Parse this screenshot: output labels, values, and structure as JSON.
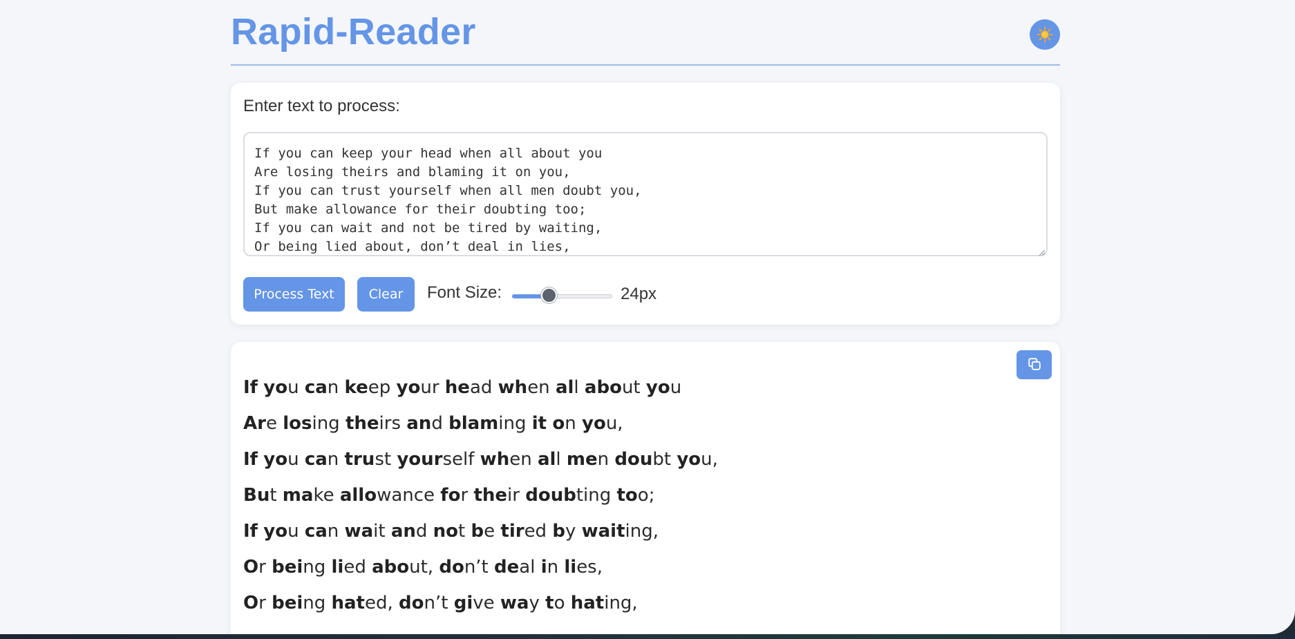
{
  "app": {
    "title": "Rapid-Reader"
  },
  "header": {
    "theme_toggle_icon": "sun-icon"
  },
  "input": {
    "label": "Enter text to process:",
    "text": "If you can keep your head when all about you\nAre losing theirs and blaming it on you,\nIf you can trust yourself when all men doubt you,\nBut make allowance for their doubting too;\nIf you can wait and not be tired by waiting,\nOr being lied about, don’t deal in lies,"
  },
  "controls": {
    "process_label": "Process Text",
    "clear_label": "Clear",
    "font_size_label": "Font Size:",
    "font_size_value": "24px",
    "font_size_slider_fraction": 0.375
  },
  "output": {
    "copy_icon": "copy-icon",
    "lines": [
      [
        [
          "If",
          " "
        ],
        [
          "yo",
          "u "
        ],
        [
          "ca",
          "n "
        ],
        [
          "ke",
          "ep "
        ],
        [
          "yo",
          "ur "
        ],
        [
          "he",
          "ad "
        ],
        [
          "wh",
          "en "
        ],
        [
          "al",
          "l "
        ],
        [
          "abo",
          "ut "
        ],
        [
          "yo",
          "u"
        ]
      ],
      [
        [
          "Ar",
          "e "
        ],
        [
          "los",
          "ing "
        ],
        [
          "the",
          "irs "
        ],
        [
          "an",
          "d "
        ],
        [
          "blam",
          "ing "
        ],
        [
          "it",
          " "
        ],
        [
          "o",
          "n "
        ],
        [
          "yo",
          "u,"
        ]
      ],
      [
        [
          "If",
          " "
        ],
        [
          "yo",
          "u "
        ],
        [
          "ca",
          "n "
        ],
        [
          "tru",
          "st "
        ],
        [
          "your",
          "self "
        ],
        [
          "wh",
          "en "
        ],
        [
          "al",
          "l "
        ],
        [
          "me",
          "n "
        ],
        [
          "dou",
          "bt "
        ],
        [
          "yo",
          "u,"
        ]
      ],
      [
        [
          "Bu",
          "t "
        ],
        [
          "ma",
          "ke "
        ],
        [
          "allo",
          "wance "
        ],
        [
          "fo",
          "r "
        ],
        [
          "the",
          "ir "
        ],
        [
          "doub",
          "ting "
        ],
        [
          "to",
          "o;"
        ]
      ],
      [
        [
          "If",
          " "
        ],
        [
          "yo",
          "u "
        ],
        [
          "ca",
          "n "
        ],
        [
          "wa",
          "it "
        ],
        [
          "an",
          "d "
        ],
        [
          "no",
          "t "
        ],
        [
          "b",
          "e "
        ],
        [
          "tir",
          "ed "
        ],
        [
          "b",
          "y "
        ],
        [
          "wait",
          "ing,"
        ]
      ],
      [
        [
          "O",
          "r "
        ],
        [
          "bei",
          "ng "
        ],
        [
          "li",
          "ed "
        ],
        [
          "abo",
          "ut, "
        ],
        [
          "do",
          "n’t "
        ],
        [
          "de",
          "al "
        ],
        [
          "i",
          "n "
        ],
        [
          "li",
          "es,"
        ]
      ],
      [
        [
          "O",
          "r "
        ],
        [
          "bei",
          "ng "
        ],
        [
          "hat",
          "ed, "
        ],
        [
          "do",
          "n’t "
        ],
        [
          "gi",
          "ve "
        ],
        [
          "wa",
          "y "
        ],
        [
          "t",
          "o "
        ],
        [
          "hat",
          "ing,"
        ]
      ]
    ]
  },
  "colors": {
    "accent": "#6495e6",
    "background": "#f4f6fa",
    "card": "#ffffff",
    "text": "#333333"
  }
}
